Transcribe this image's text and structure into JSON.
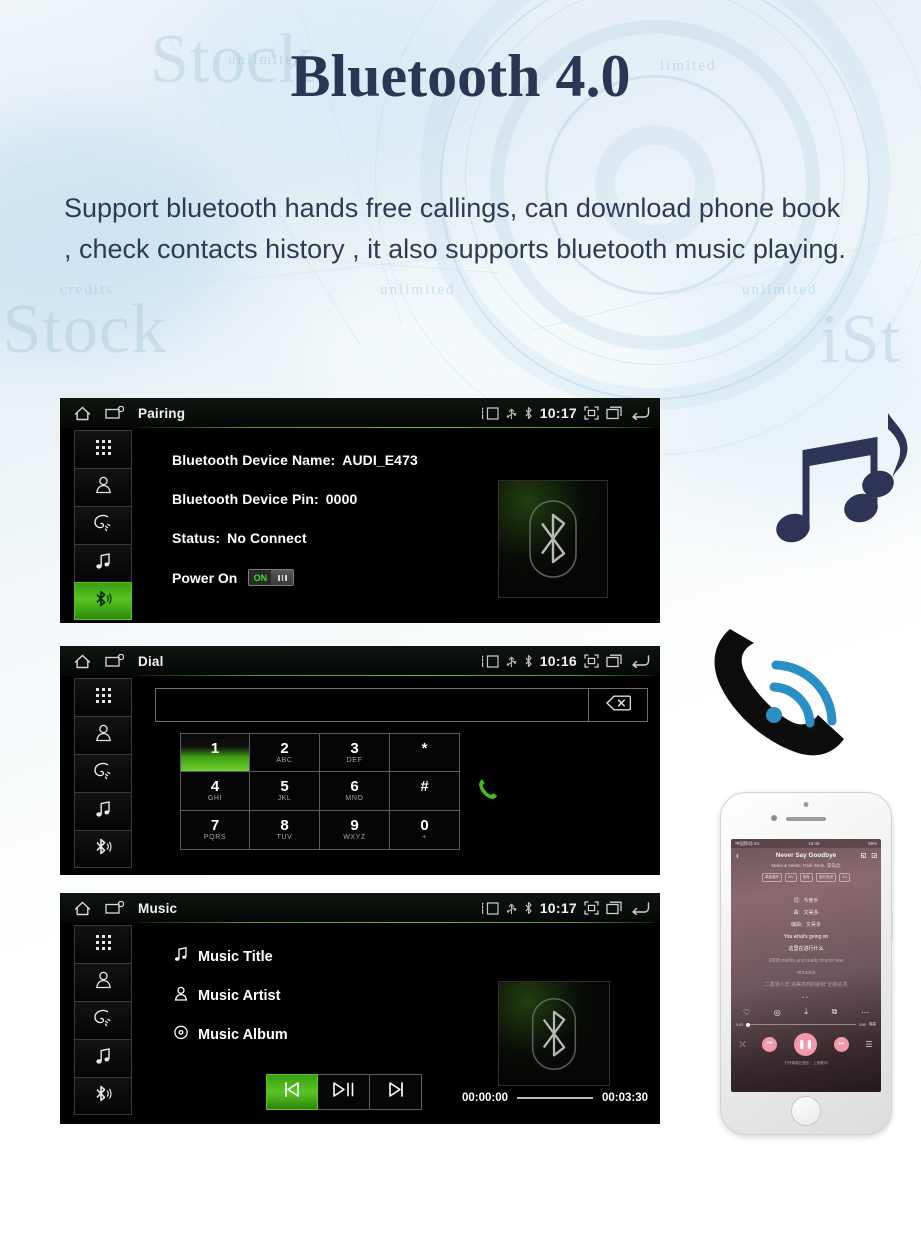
{
  "page": {
    "headline": "Bluetooth 4.0",
    "intro": "Support bluetooth hands free callings, can download phone book , check contacts history , it also supports bluetooth music playing."
  },
  "colors": {
    "accent_green": "#55c422",
    "headline_navy": "#2b3654",
    "screen_black": "#000000",
    "phone_call_icon": "#0d0d0d",
    "wifi_blue": "#2a8fc4",
    "note_navy": "#2e3455"
  },
  "rail": {
    "items": [
      {
        "name": "keypad",
        "icon": "dialpad-icon",
        "active_on": []
      },
      {
        "name": "contacts",
        "icon": "contact-person-icon",
        "active_on": []
      },
      {
        "name": "call-history",
        "icon": "call-history-icon",
        "active_on": []
      },
      {
        "name": "music",
        "icon": "music-note-icon",
        "active_on": []
      },
      {
        "name": "bluetooth",
        "icon": "bluetooth-icon",
        "active_on": [
          "pairing"
        ]
      }
    ]
  },
  "statusbar": {
    "icons": [
      "cast-icon",
      "usb-icon",
      "bluetooth-icon"
    ],
    "right_icons": [
      "screenshot-icon",
      "recents-icon",
      "back-icon"
    ],
    "home_icon": "home-icon",
    "apps_icon": "app-window-icon"
  },
  "pairing": {
    "title": "Pairing",
    "time": "10:17",
    "rows": [
      {
        "label": "Bluetooth Device Name:",
        "value": "AUDI_E473"
      },
      {
        "label": "Bluetooth Device Pin:",
        "value": "0000"
      },
      {
        "label": "Status:",
        "value": "No Connect"
      }
    ],
    "power_label": "Power On",
    "toggle_state": "ON",
    "art_icon": "bluetooth-logo"
  },
  "dial": {
    "title": "Dial",
    "time": "10:16",
    "input_value": "",
    "backspace_icon": "backspace-icon",
    "call_icon": "call-icon",
    "keys": [
      {
        "digit": "1",
        "letters": ""
      },
      {
        "digit": "2",
        "letters": "ABC"
      },
      {
        "digit": "3",
        "letters": "DEF"
      },
      {
        "digit": "*",
        "letters": ""
      },
      {
        "digit": "4",
        "letters": "GHI"
      },
      {
        "digit": "5",
        "letters": "JKL"
      },
      {
        "digit": "6",
        "letters": "MNO"
      },
      {
        "digit": "#",
        "letters": ""
      },
      {
        "digit": "7",
        "letters": "PQRS"
      },
      {
        "digit": "8",
        "letters": "TUV"
      },
      {
        "digit": "9",
        "letters": "WXYZ"
      },
      {
        "digit": "0",
        "letters": "+"
      }
    ]
  },
  "music": {
    "title": "Music",
    "time": "10:17",
    "rows": [
      {
        "icon": "music-note-icon",
        "label": "Music Title"
      },
      {
        "icon": "artist-person-icon",
        "label": "Music Artist"
      },
      {
        "icon": "album-disc-icon",
        "label": "Music Album"
      }
    ],
    "transport": [
      {
        "name": "previous",
        "icon": "previous-track-icon"
      },
      {
        "name": "play-pause",
        "icon": "play-pause-icon"
      },
      {
        "name": "next",
        "icon": "next-track-icon"
      }
    ],
    "elapsed": "00:00:00",
    "duration": "00:03:30",
    "art_icon": "bluetooth-logo"
  },
  "decor": {
    "music_notes_icon": "music-notes-illustration",
    "phone_handset_icon": "phone-handset-illustration",
    "signal_waves_icon": "signal-waves-icon"
  },
  "smartphone": {
    "status_left": "中国移动 4G",
    "status_center": "16:46",
    "status_right": "59%",
    "song_title": "Never Say Goodbye",
    "artists": "Mario & Nesto, Park Smin, 李知念",
    "chips": [
      "单曲循环",
      "MV",
      "音效",
      "定时关闭",
      "1/4"
    ],
    "lyric_lines": [
      "词：今使手",
      "曲：文昊多",
      "编曲：文昊多",
      "You what's going on",
      "这里在进行什么"
    ],
    "lyric_dim": [
      "2008 marks and ready brand new",
      "vibration",
      "二黑零八年 完美亮到的新鲜 全新征兆"
    ],
    "progress_elapsed": "0:03",
    "progress_total": "3:50",
    "progress_badge": "极高",
    "bottom_hint": "打开网易云音乐，上传歌词",
    "action_icons": [
      "heart-icon",
      "comment-icon",
      "download-icon",
      "repeat-icon",
      "more-icon"
    ],
    "control_icons": [
      "shuffle-icon",
      "previous-icon",
      "pause-icon",
      "next-icon",
      "playlist-icon"
    ]
  }
}
